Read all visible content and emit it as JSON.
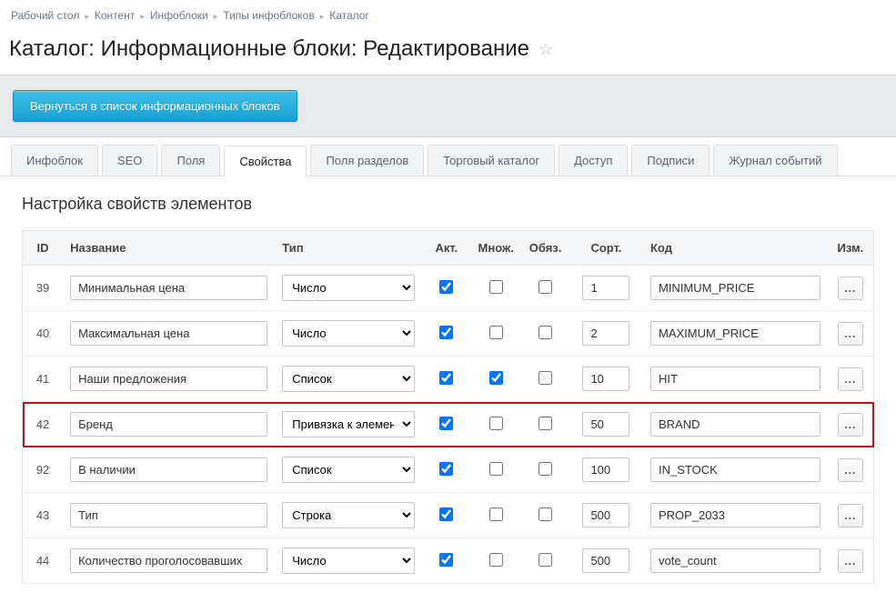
{
  "breadcrumb": [
    "Рабочий стол",
    "Контент",
    "Инфоблоки",
    "Типы инфоблоков",
    "Каталог"
  ],
  "page_title": "Каталог: Информационные блоки: Редактирование",
  "toolbar": {
    "back_label": "Вернуться в список информационных блоков"
  },
  "tabs": [
    "Инфоблок",
    "SEO",
    "Поля",
    "Свойства",
    "Поля разделов",
    "Торговый каталог",
    "Доступ",
    "Подписи",
    "Журнал событий"
  ],
  "active_tab_index": 3,
  "section_title": "Настройка свойств элементов",
  "columns": {
    "id": "ID",
    "name": "Название",
    "type": "Тип",
    "active": "Акт.",
    "multi": "Множ.",
    "required": "Обяз.",
    "sort": "Сорт.",
    "code": "Код",
    "edit": "Изм."
  },
  "type_options": [
    "Число",
    "Список",
    "Строка",
    "Привязка к элементам"
  ],
  "rows": [
    {
      "id": "39",
      "name": "Минимальная цена",
      "type": "Число",
      "active": true,
      "multi": false,
      "required": false,
      "sort": "1",
      "code": "MINIMUM_PRICE",
      "highlight": false
    },
    {
      "id": "40",
      "name": "Максимальная цена",
      "type": "Число",
      "active": true,
      "multi": false,
      "required": false,
      "sort": "2",
      "code": "MAXIMUM_PRICE",
      "highlight": false
    },
    {
      "id": "41",
      "name": "Наши предложения",
      "type": "Список",
      "active": true,
      "multi": true,
      "required": false,
      "sort": "10",
      "code": "HIT",
      "highlight": false
    },
    {
      "id": "42",
      "name": "Бренд",
      "type": "Привязка к элементам",
      "active": true,
      "multi": false,
      "required": false,
      "sort": "50",
      "code": "BRAND",
      "highlight": true
    },
    {
      "id": "92",
      "name": "В наличии",
      "type": "Список",
      "active": true,
      "multi": false,
      "required": false,
      "sort": "100",
      "code": "IN_STOCK",
      "highlight": false
    },
    {
      "id": "43",
      "name": "Тип",
      "type": "Строка",
      "active": true,
      "multi": false,
      "required": false,
      "sort": "500",
      "code": "PROP_2033",
      "highlight": false
    },
    {
      "id": "44",
      "name": "Количество проголосовавших",
      "type": "Число",
      "active": true,
      "multi": false,
      "required": false,
      "sort": "500",
      "code": "vote_count",
      "highlight": false
    }
  ],
  "more_glyph": "..."
}
